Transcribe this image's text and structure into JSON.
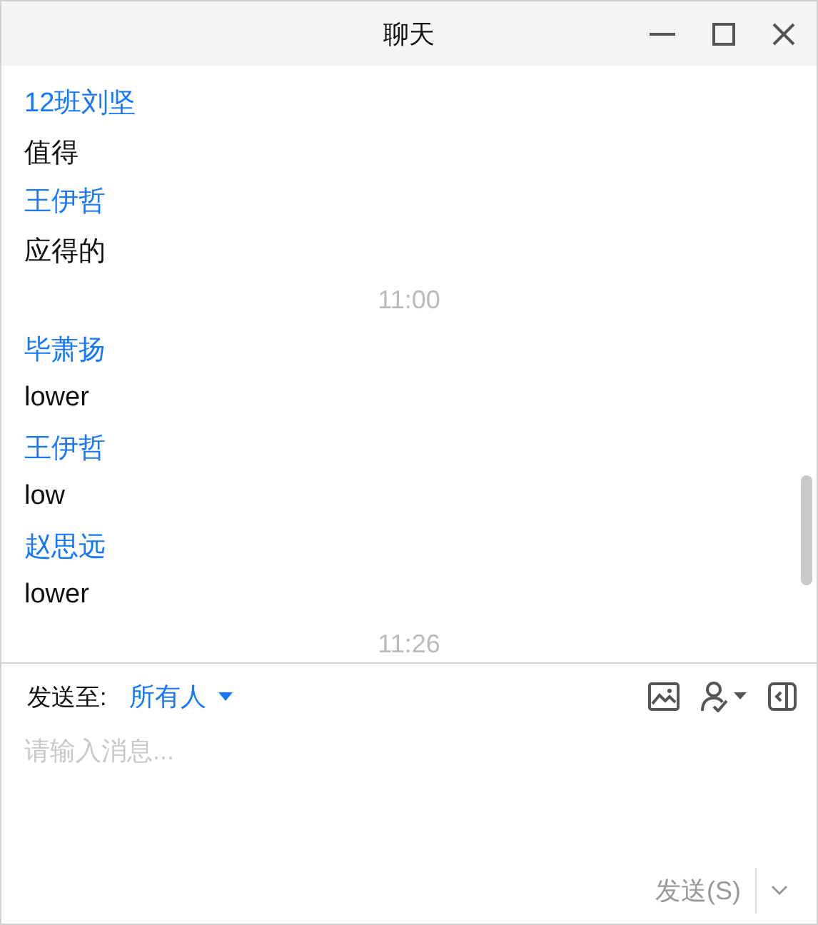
{
  "window": {
    "title": "聊天"
  },
  "messages": [
    {
      "kind": "message",
      "sender": "12班刘坚",
      "text": "值得"
    },
    {
      "kind": "message",
      "sender": "王伊哲",
      "text": "应得的"
    },
    {
      "kind": "time",
      "text": "11:00"
    },
    {
      "kind": "message",
      "sender": "毕萧扬",
      "text": "lower"
    },
    {
      "kind": "message",
      "sender": "王伊哲",
      "text": "low"
    },
    {
      "kind": "message",
      "sender": "赵思远",
      "text": "lower"
    },
    {
      "kind": "time",
      "text": "11:26"
    }
  ],
  "compose": {
    "send_to_label": "发送至:",
    "recipient": "所有人",
    "placeholder": "请输入消息...",
    "send_button": "发送(S)"
  }
}
